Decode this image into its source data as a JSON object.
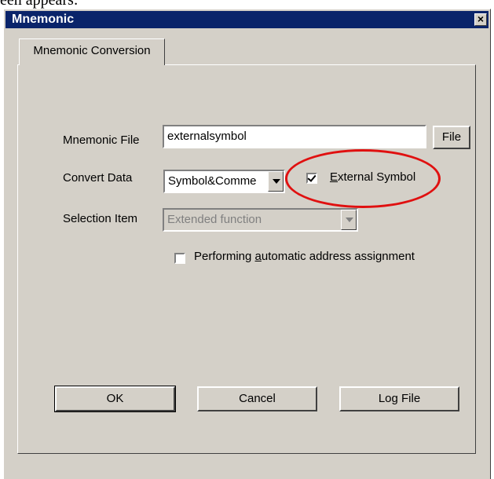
{
  "caption": "een appears:",
  "window": {
    "title": "Mnemonic",
    "close_glyph": "×"
  },
  "tab": {
    "label": "Mnemonic Conversion"
  },
  "form": {
    "mnemonic_file_label": "Mnemonic File",
    "mnemonic_file_value": "externalsymbol",
    "file_button_label": "File",
    "convert_data_label": "Convert Data",
    "convert_data_value": "Symbol&Comme",
    "external_symbol_label": "External Symbol",
    "external_symbol_checked": true,
    "selection_item_label": "Selection Item",
    "selection_item_value": "Extended function",
    "selection_item_enabled": false,
    "auto_address_label": "Performing automatic address assignment",
    "auto_address_checked": false
  },
  "buttons": {
    "ok": "OK",
    "cancel": "Cancel",
    "log_file": "Log File"
  },
  "annotation": {
    "highlight_color": "#e01010"
  }
}
